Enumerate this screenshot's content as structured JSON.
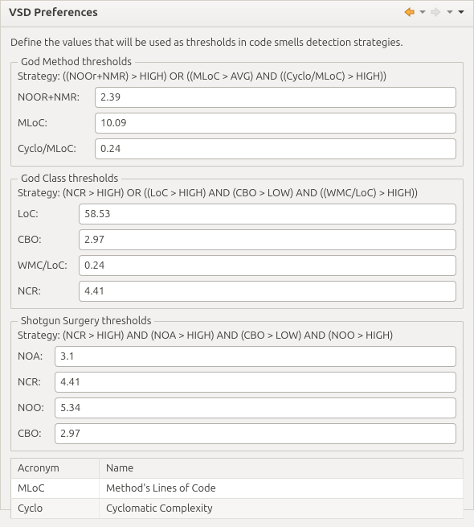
{
  "title": "VSD Preferences",
  "intro": "Define the values that will be used as thresholds in code smells detection strategies.",
  "godMethod": {
    "legend": "God Method thresholds",
    "strategy": "Strategy: ((NOOr+NMR) > HIGH) OR ((MLoC > AVG) AND ((Cyclo/MLoC) > HIGH))",
    "fields": {
      "noornmr": {
        "label": "NOOR+NMR:",
        "value": "2.39"
      },
      "mloc": {
        "label": "MLoC:",
        "value": "10.09"
      },
      "cycloMloc": {
        "label": "Cyclo/MLoC:",
        "value": "0.24"
      }
    }
  },
  "godClass": {
    "legend": "God Class thresholds",
    "strategy": "Strategy: (NCR > HIGH) OR ((LoC > HIGH) AND (CBO > LOW) AND ((WMC/LoC) > HIGH))",
    "fields": {
      "loc": {
        "label": "LoC:",
        "value": "58.53"
      },
      "cbo": {
        "label": "CBO:",
        "value": "2.97"
      },
      "wmcLoc": {
        "label": "WMC/LoC:",
        "value": "0.24"
      },
      "ncr": {
        "label": "NCR:",
        "value": "4.41"
      }
    }
  },
  "shotgun": {
    "legend": "Shotgun Surgery thresholds",
    "strategy": "Strategy: (NCR > HIGH) AND (NOA > HIGH) AND (CBO > LOW) AND (NOO > HIGH)",
    "fields": {
      "noa": {
        "label": "NOA:",
        "value": "3.1"
      },
      "ncr": {
        "label": "NCR:",
        "value": "4.41"
      },
      "noo": {
        "label": "NOO:",
        "value": "5.34"
      },
      "cbo": {
        "label": "CBO:",
        "value": "2.97"
      }
    }
  },
  "table": {
    "headers": {
      "acronym": "Acronym",
      "name": "Name"
    },
    "rows": [
      {
        "acronym": "MLoC",
        "name": "Method's Lines of Code"
      },
      {
        "acronym": "Cyclo",
        "name": "Cyclomatic Complexity"
      }
    ]
  }
}
